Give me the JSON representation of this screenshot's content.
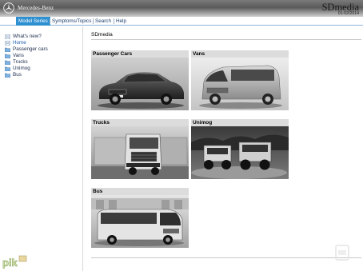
{
  "header": {
    "brand": "Mercedes-Benz",
    "app_title": "SDmedia",
    "date": "01-02/2014"
  },
  "menu": [
    {
      "label": "Model Series",
      "active": true
    },
    {
      "label": "Symptoms/Topics",
      "active": false
    },
    {
      "label": "Search",
      "active": false
    },
    {
      "label": "Help",
      "active": false
    }
  ],
  "sidebar": {
    "items": [
      {
        "label": "What's new?",
        "icon": "page-icon"
      },
      {
        "label": "Home",
        "icon": "page-icon",
        "selected": true
      },
      {
        "label": "Passenger cars",
        "icon": "folder-icon"
      },
      {
        "label": "Vans",
        "icon": "folder-icon"
      },
      {
        "label": "Trucks",
        "icon": "folder-icon"
      },
      {
        "label": "Unimog",
        "icon": "folder-icon"
      },
      {
        "label": "Bus",
        "icon": "folder-icon"
      }
    ]
  },
  "main": {
    "title": "SDmedia",
    "categories": [
      {
        "label": "Passenger Cars",
        "image": "sedan-photo"
      },
      {
        "label": "Vans",
        "image": "van-photo"
      },
      {
        "label": "Trucks",
        "image": "truck-photo"
      },
      {
        "label": "Unimog",
        "image": "unimog-photo"
      },
      {
        "label": "Bus",
        "image": "bus-photo"
      }
    ]
  },
  "watermark": {
    "text": "pik"
  },
  "colors": {
    "menu_active": "#2e8fd1",
    "link": "#1a3d6e",
    "card_header": "#dcdcdc",
    "folder": "#7fb2e0"
  }
}
